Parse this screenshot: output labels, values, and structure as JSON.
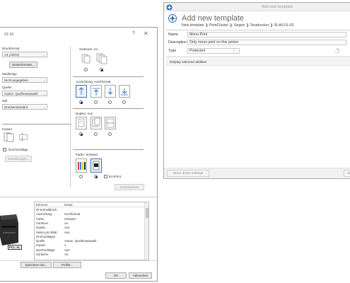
{
  "printer_dialog": {
    "title": ".01-03",
    "help": "?",
    "close": "✕",
    "left": {
      "format_label": "Druckformat",
      "format_value": "A4 (100%)",
      "page_format_button": "Seitenformate...",
      "media_label": "Medientyp",
      "media_value": "Nicht angegeben",
      "source_label": "Quelle",
      "source_value": "Autom. Quellenauswahl",
      "target_label": "Ziel",
      "target_value": "Druckerstandard",
      "copies_label": "Kopien",
      "copies_value": "1",
      "duplex_check_label": "Durchschläge",
      "settings_button": "Einstellungen..."
    },
    "right": {
      "sort_label": "Sortieren: An",
      "orientation_label": "Ausrichtung: Hochformat",
      "duplex_label": "Duplex: Aus",
      "color_label": "Farbe: Schwarz",
      "ecoprint_label": "EcoPrint",
      "default_button": "Zurücksetzen"
    },
    "preview_badge": "PCL XL",
    "table": {
      "col_element": "Element",
      "col_detail": "Detail",
      "rows": [
        {
          "k": "⊟ Schnelldruck",
          "v": ""
        },
        {
          "k": "     Ausrichtung",
          "v": "Hochformat"
        },
        {
          "k": "     Farbe",
          "v": "Schwarz"
        },
        {
          "k": "     Sortieren",
          "v": "An"
        },
        {
          "k": "     Duplex",
          "v": "Aus"
        },
        {
          "k": "     Seiten pro Blatt",
          "v": "Aus"
        },
        {
          "k": "⊟ Grundlagen",
          "v": ""
        },
        {
          "k": "     Quelle",
          "v": "Autom. Quellenauswahl"
        },
        {
          "k": "     Kopien",
          "v": "1"
        },
        {
          "k": "     Durchschläge",
          "v": "Aus"
        },
        {
          "k": "     Sortieren",
          "v": "An"
        }
      ]
    },
    "footer": {
      "save_as": "Speichern als...",
      "profile": "Profile...",
      "ok": "OK",
      "cancel": "Abbrechen"
    }
  },
  "template_window": {
    "window_title": "Add new template",
    "heading": "Add new template",
    "breadcrumb": "New template ❯ PrintCluster ❯ Siegen ❯ Testdrucker ❯ SI-A0.01-03",
    "fields": {
      "name_label": "Name",
      "name_value": "Mono-Print",
      "description_label": "Description",
      "description_value": "Only mono print on this printer",
      "type_label": "Type",
      "type_value": "Protected"
    },
    "abilities_label": "Display selected abilities",
    "open_driver_settings": "Open driver settings",
    "save_partial": "Sa"
  },
  "colors": {
    "accent": "#3a73c2",
    "logo": "#2a6db5"
  }
}
